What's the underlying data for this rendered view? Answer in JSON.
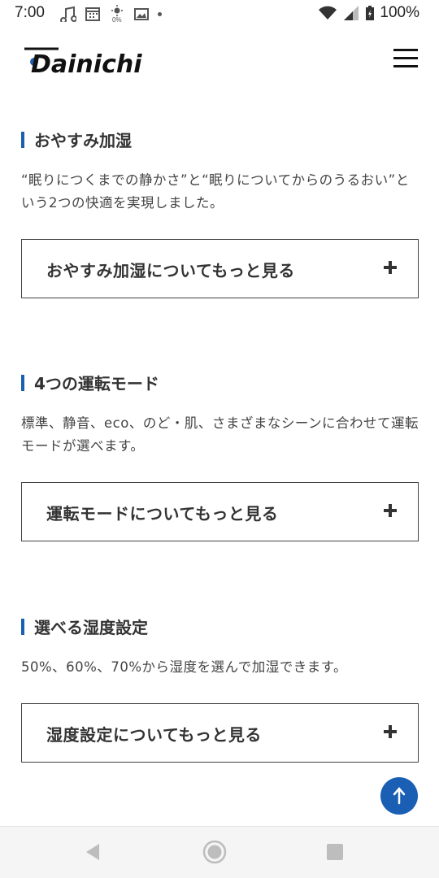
{
  "status_bar": {
    "time": "7:00",
    "battery": "100%",
    "icons_left": [
      "music-note-icon",
      "calendar-icon",
      "weather-icon",
      "photo-icon",
      "dot-icon"
    ],
    "icons_right": [
      "wifi-icon",
      "signal-icon",
      "battery-icon"
    ]
  },
  "header": {
    "logo_text": "Dainichi",
    "menu_icon": "hamburger-menu-icon"
  },
  "sections": [
    {
      "title": "おやすみ加湿",
      "description": "“眠りにつくまでの静かさ”と“眠りについてからのうるおい”という2つの快適を実現しました。",
      "button_label": "おやすみ加湿についてもっと見る"
    },
    {
      "title": "4つの運転モード",
      "description": "標準、静音、eco、のど・肌、さまざまなシーンに合わせて運転モードが選べます。",
      "button_label": "運転モードについてもっと見る"
    },
    {
      "title": "選べる湿度設定",
      "description": "50%、60%、70%から湿度を選んで加湿できます。",
      "button_label": "湿度設定についてもっと見る"
    }
  ],
  "scroll_top_icon": "arrow-up-icon",
  "colors": {
    "accent": "#1b5fb0",
    "text": "#333333",
    "button_border": "#444444"
  },
  "nav_bar": {
    "icons": [
      "back-icon",
      "home-icon",
      "recent-apps-icon"
    ]
  }
}
